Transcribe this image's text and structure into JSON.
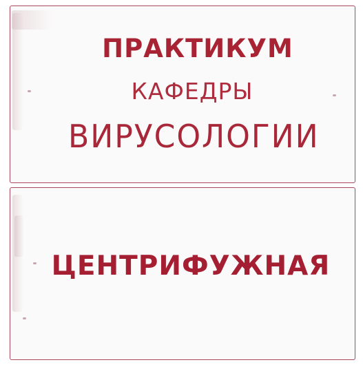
{
  "signs": {
    "top": {
      "line1": "ПРАКТИКУМ",
      "line2": "КАФЕДРЫ",
      "line3": "ВИРУСОЛОГИИ"
    },
    "bottom": {
      "line1": "ЦЕНТРИФУЖНАЯ"
    }
  },
  "colors": {
    "lettering": "#a82435",
    "border": "#a8485a",
    "background": "#fbfafa"
  }
}
